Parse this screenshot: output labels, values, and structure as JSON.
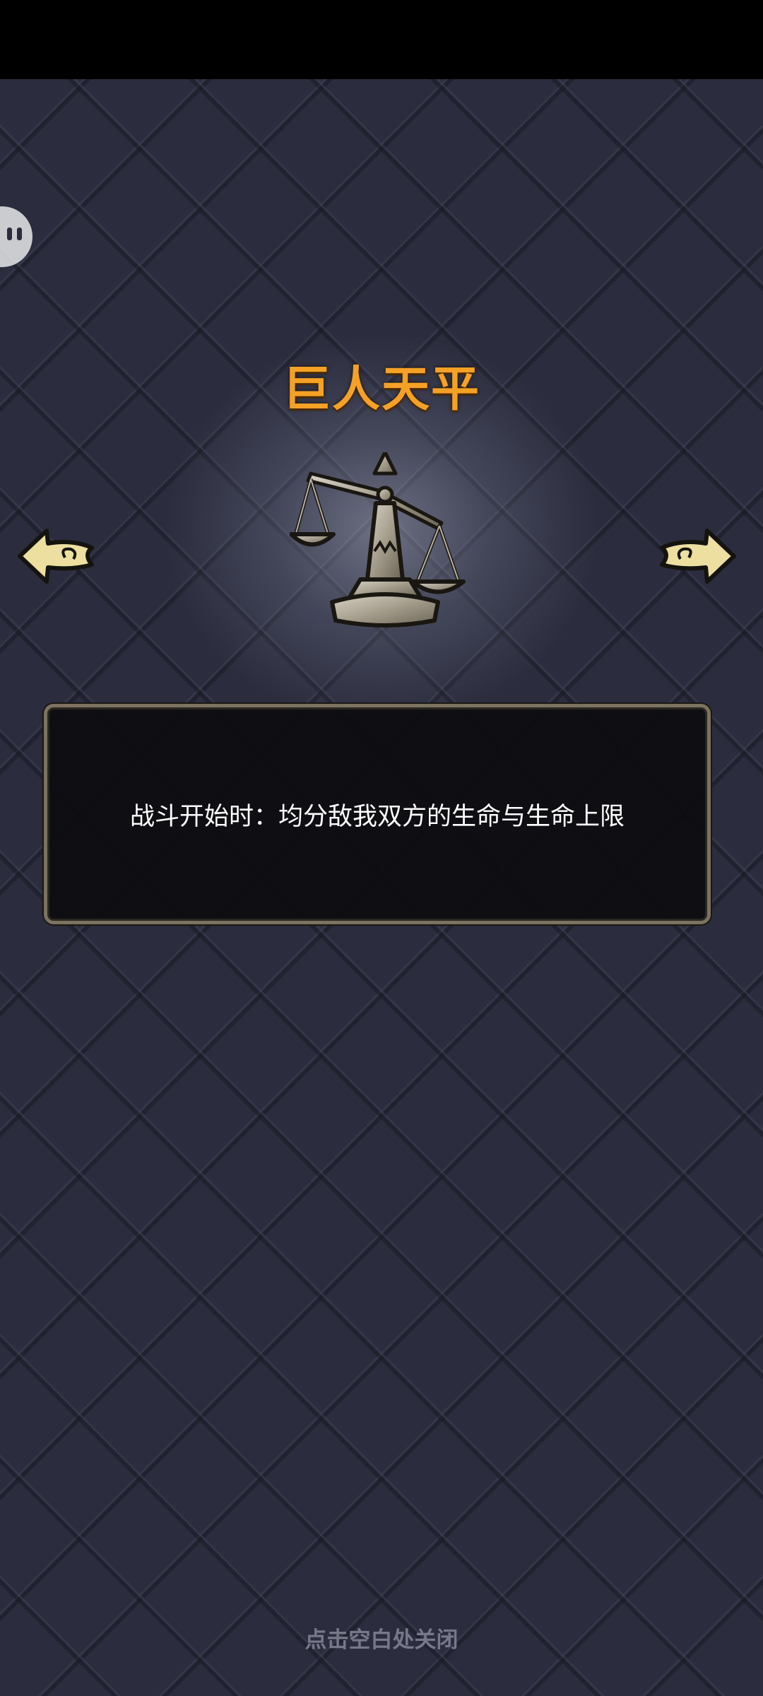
{
  "item": {
    "title": "巨人天平",
    "description": "战斗开始时：均分敌我双方的生命与生命上限",
    "icon": "balance-scale-icon"
  },
  "navigation": {
    "prev_icon": "arrow-left-icon",
    "next_icon": "arrow-right-icon"
  },
  "footer": {
    "close_hint": "点击空白处关闭"
  },
  "colors": {
    "title": "#f5a126",
    "background": "#2b2d3e",
    "panel_border": "#7d7261",
    "hint": "#77798a"
  }
}
